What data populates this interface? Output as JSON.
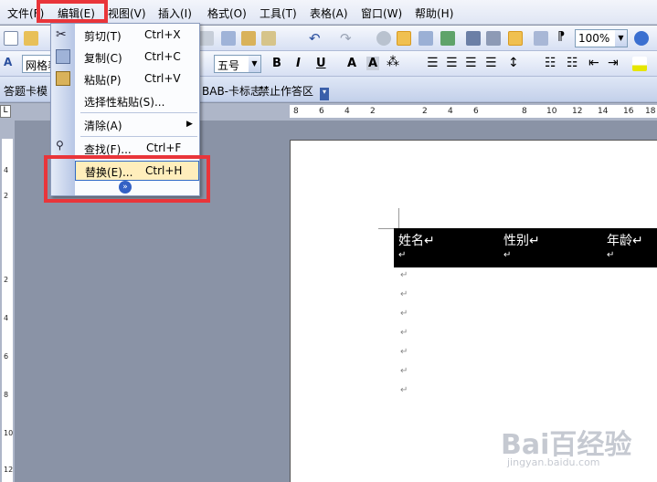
{
  "menubar": {
    "items": [
      "文件(F)",
      "编辑(E)",
      "视图(V)",
      "插入(I)",
      "格式(O)",
      "工具(T)",
      "表格(A)",
      "窗口(W)",
      "帮助(H)"
    ]
  },
  "toolbar": {
    "zoom": "100%",
    "style": "网格表",
    "font_size": "五号",
    "bold": "B",
    "italic": "I",
    "underline": "U",
    "font_a": "A",
    "font_a_box": "A"
  },
  "toolbar3": {
    "items": [
      "答题卡模",
      "BAB-卡标志",
      "禁止作答区"
    ]
  },
  "ruler": {
    "top": [
      "8",
      "6",
      "4",
      "2",
      "2",
      "4",
      "6",
      "8",
      "10",
      "12",
      "14",
      "16",
      "18"
    ],
    "left": [
      "4",
      "2",
      "2",
      "4",
      "6",
      "8",
      "10",
      "12"
    ]
  },
  "edit_menu": {
    "items": [
      {
        "label": "剪切(T)",
        "shortcut": "Ctrl+X"
      },
      {
        "label": "复制(C)",
        "shortcut": "Ctrl+C"
      },
      {
        "label": "粘贴(P)",
        "shortcut": "Ctrl+V"
      },
      {
        "label": "选择性粘贴(S)...",
        "shortcut": ""
      },
      {
        "label": "清除(A)",
        "shortcut": ""
      },
      {
        "label": "查找(F)...",
        "shortcut": "Ctrl+F"
      },
      {
        "label": "替换(E)...",
        "shortcut": "Ctrl+H"
      }
    ]
  },
  "document": {
    "headers": [
      "姓名↵",
      "性别↵",
      "年龄↵"
    ],
    "paragraph_mark": "↵"
  },
  "watermark": {
    "brand": "Bai百经验",
    "url": "jingyan.baidu.com"
  },
  "colors": {
    "highlight": "#e9353a",
    "menu_hover": "#ffeebc"
  }
}
